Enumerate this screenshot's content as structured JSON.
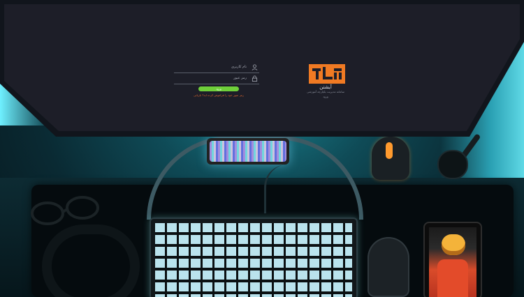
{
  "brand": {
    "name": "آیشتن",
    "tagline": "سامانه مدیریت یکپارچه آموزشی",
    "sub": "ورود",
    "accent": "#f07a23"
  },
  "login": {
    "username_label": "نام کاربری",
    "password_label": "رمز عبور",
    "submit_label": "ورود",
    "hint": "رمز عبور خود را فراموش کرده اید؟ بازیابی",
    "button_color": "#6fcf3a"
  }
}
